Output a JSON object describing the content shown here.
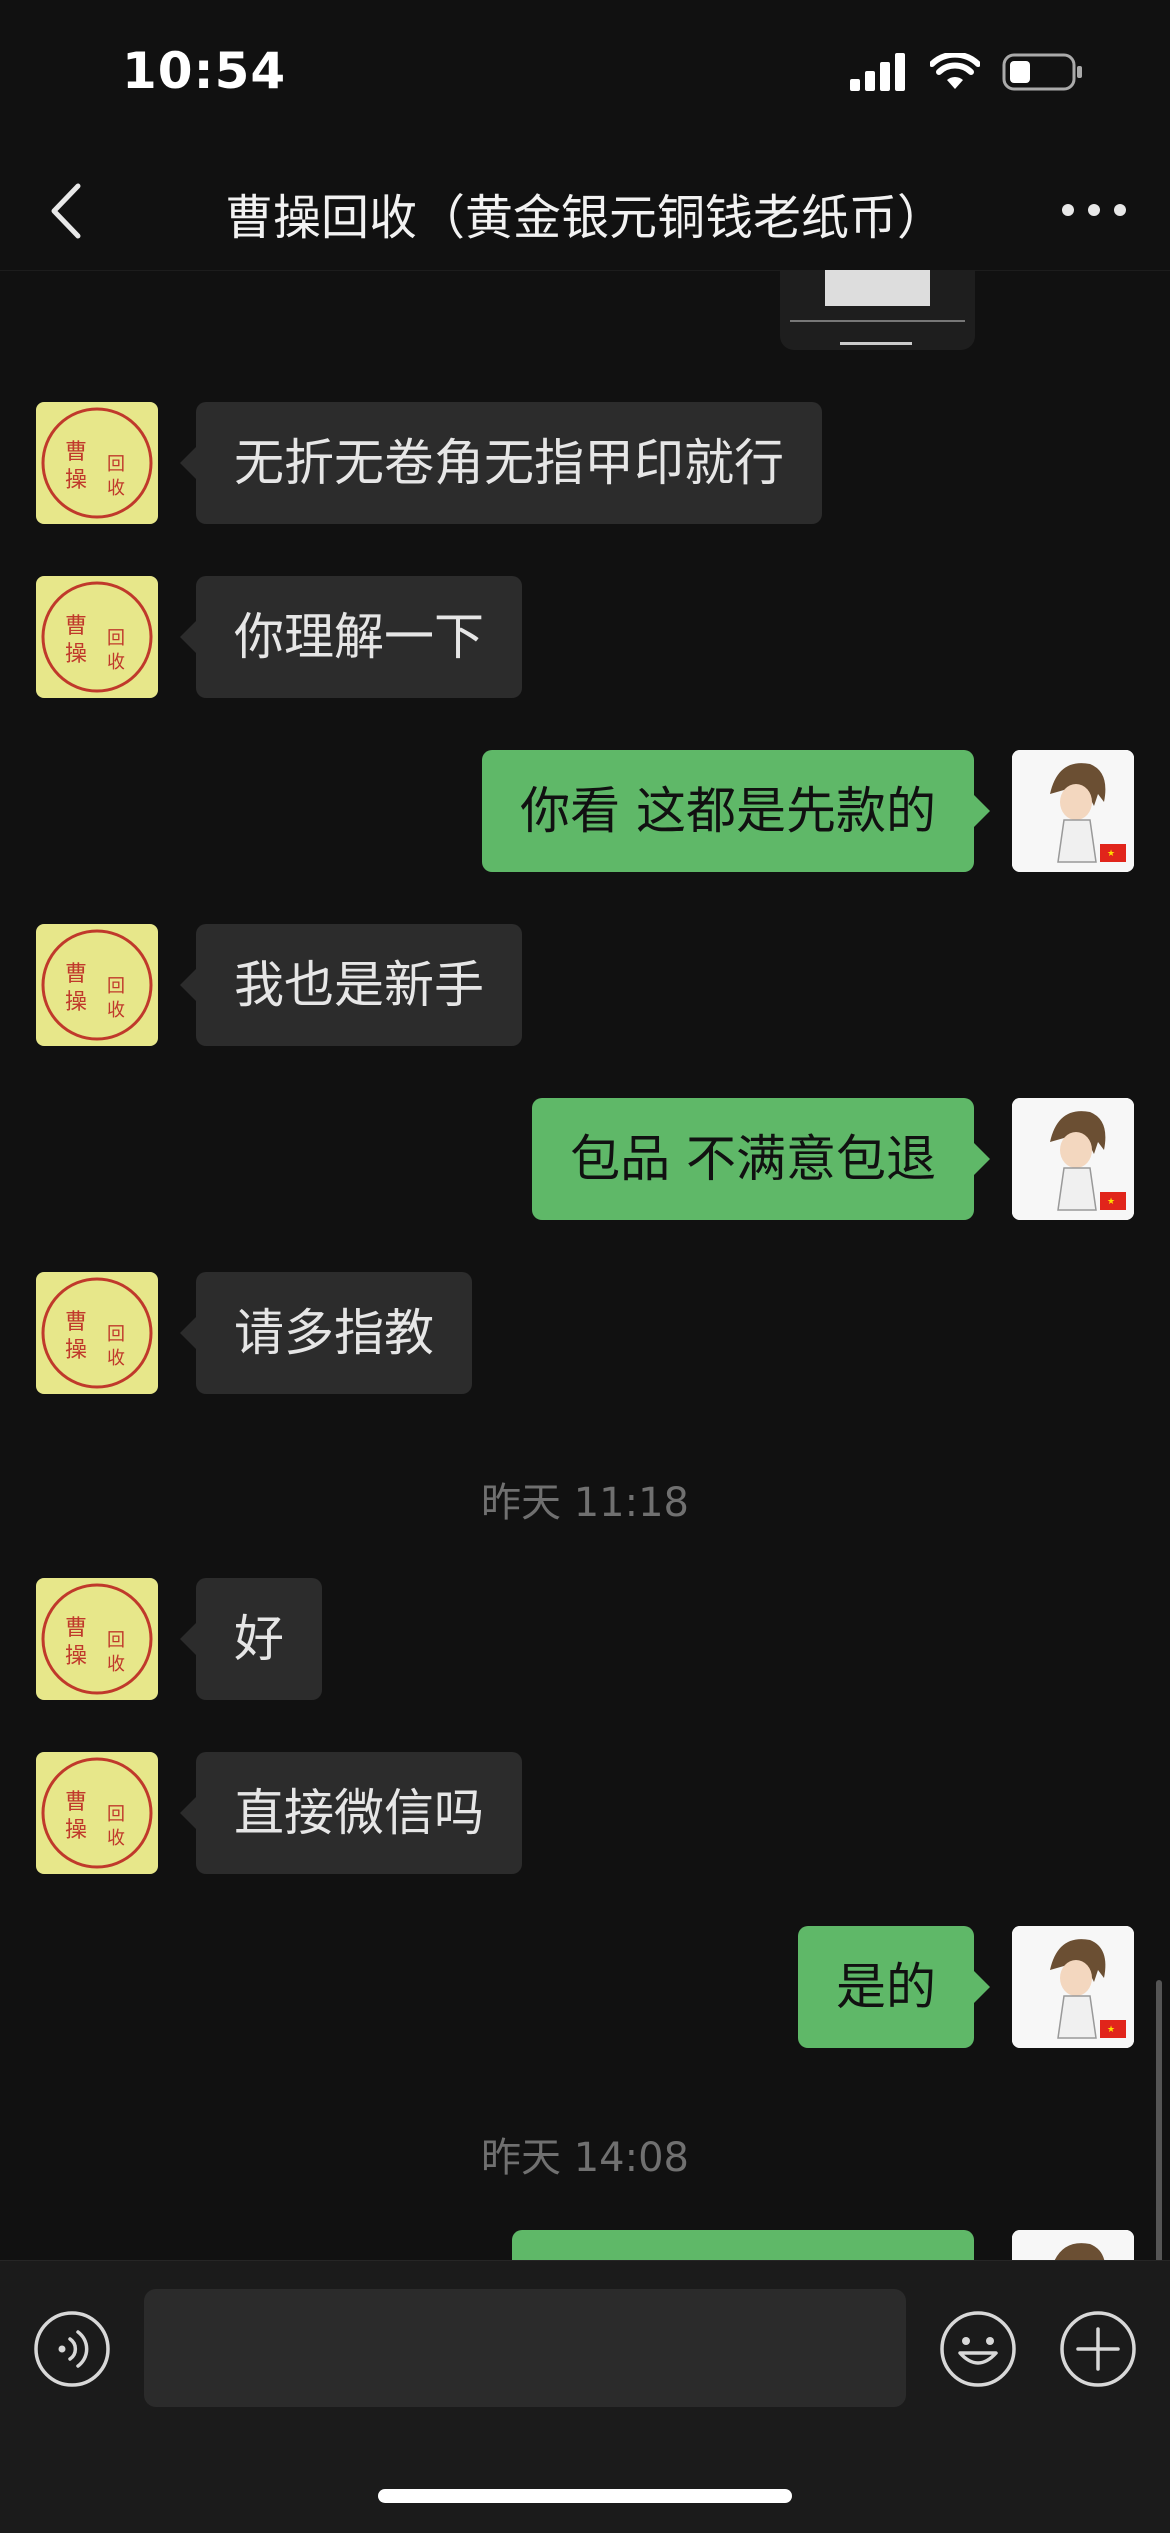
{
  "status_bar": {
    "time": "10:54",
    "signal": "signal-icon",
    "wifi": "wifi-icon",
    "battery": "battery-icon"
  },
  "header": {
    "title": "曹操回收（黄金银元铜钱老纸币）",
    "back_icon": "chevron-left-icon",
    "more_icon": "more-icon"
  },
  "contact": {
    "avatar_text": [
      "曹",
      "操",
      "回",
      "收"
    ],
    "avatar_color": "#e7e78a",
    "stamp_color": "#c0392b"
  },
  "messages": [
    {
      "side": "in",
      "text": "无折无卷角无指甲印就行"
    },
    {
      "side": "in",
      "text": "你理解一下"
    },
    {
      "side": "out",
      "text": "你看  这都是先款的"
    },
    {
      "side": "in",
      "text": "我也是新手"
    },
    {
      "side": "out",
      "text": "包品  不满意包退"
    },
    {
      "side": "in",
      "text": "请多指教"
    },
    {
      "type": "timestamp",
      "text": "昨天 11:18"
    },
    {
      "side": "in",
      "text": "好"
    },
    {
      "side": "in",
      "text": "直接微信吗"
    },
    {
      "side": "out",
      "text": "是的"
    },
    {
      "type": "timestamp",
      "text": "昨天 14:08"
    }
  ],
  "input_bar": {
    "voice_icon": "voice-icon",
    "emoji_icon": "emoji-icon",
    "plus_icon": "plus-icon"
  },
  "colors": {
    "background": "#111111",
    "incoming_bubble": "#2c2c2c",
    "outgoing_bubble": "#5fb868"
  }
}
